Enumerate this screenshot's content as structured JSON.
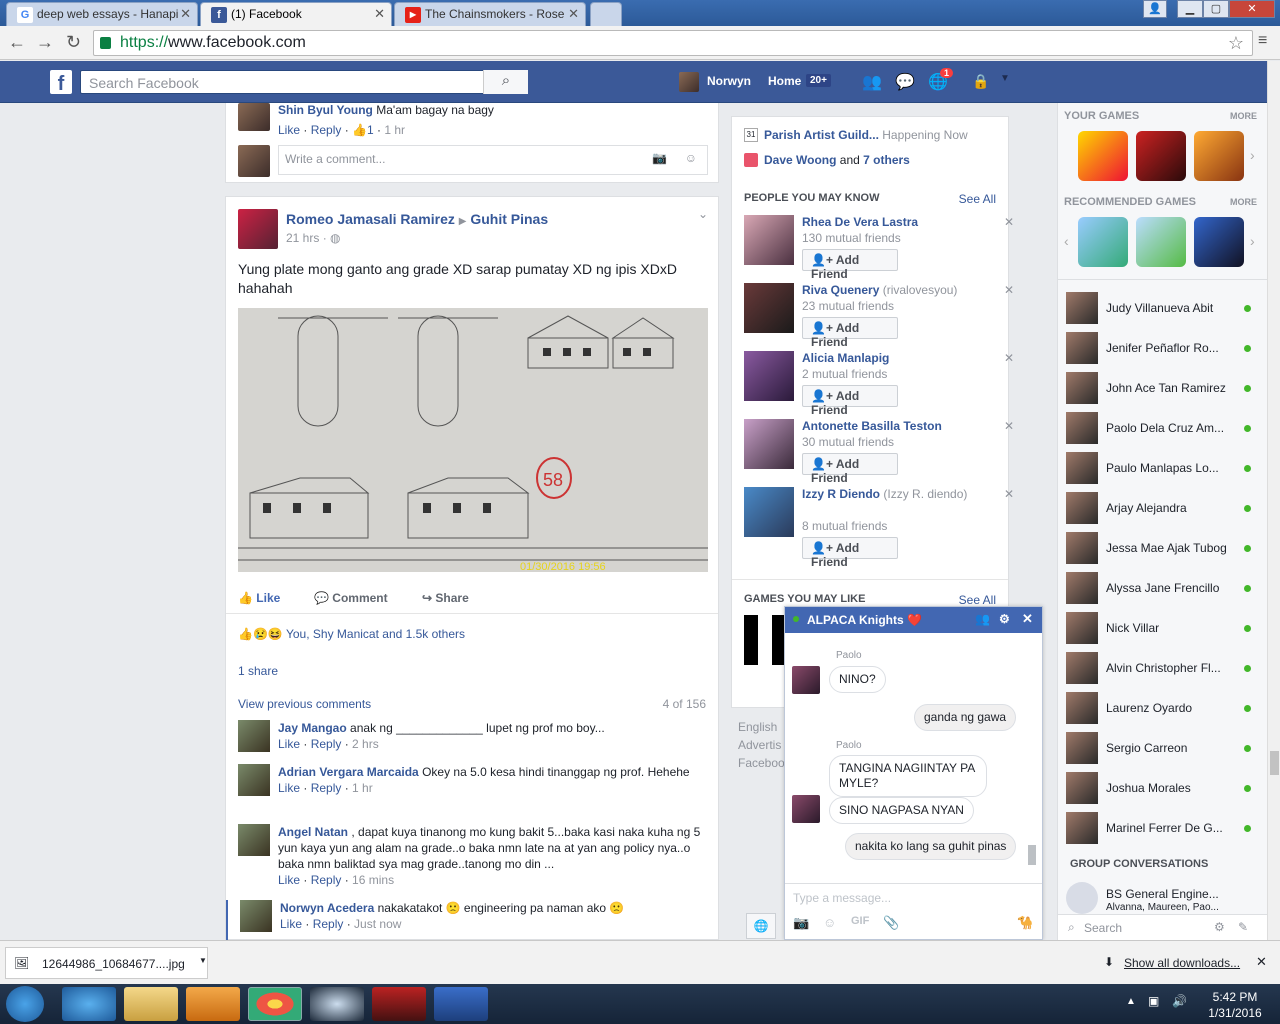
{
  "browser": {
    "tabs": [
      {
        "title": "deep web essays - Hanapi",
        "favicon": "google-icon",
        "active": false
      },
      {
        "title": "(1) Facebook",
        "favicon": "facebook-icon",
        "active": true
      },
      {
        "title": "The Chainsmokers - Rose",
        "favicon": "youtube-icon",
        "active": false
      }
    ],
    "url_scheme": "https://",
    "url_host": "www.facebook.com"
  },
  "fb_header": {
    "search_placeholder": "Search Facebook",
    "user_name": "Norwyn",
    "home_label": "Home",
    "home_badge": "20+",
    "notif_count": "1",
    "brand_color": "#3b5998"
  },
  "feed": {
    "top_comment": {
      "author": "Shin Byul Young",
      "text": "Ma'am bagay na bagy",
      "like": "Like",
      "reply": "Reply",
      "likes": "1",
      "time": "1 hr"
    },
    "write_comment_placeholder": "Write a comment...",
    "post": {
      "author": "Romeo Jamasali Ramirez",
      "group": "Guhit Pinas",
      "time": "21 hrs",
      "text": "Yung plate mong ganto ang grade XD sarap pumatay XD ng ipis XDxD hahahah",
      "photo_stamp": "01/30/2016  19:56",
      "grade_mark": "58",
      "actions": {
        "like": "Like",
        "comment": "Comment",
        "share": "Share"
      },
      "reactions": "You, Shy Manicat and 1.5k others",
      "shares": "1 share",
      "view_previous": "View previous comments",
      "comment_count": "4 of 156"
    },
    "comments": [
      {
        "author": "Jay Mangao",
        "text": "anak ng _____________ lupet ng prof mo boy...",
        "like": "Like",
        "reply": "Reply",
        "time": "2 hrs"
      },
      {
        "author": "Adrian Vergara Marcaida",
        "text": "Okey na 5.0 kesa hindi tinanggap ng prof. Hehehe",
        "like": "Like",
        "reply": "Reply",
        "time": "1 hr"
      },
      {
        "author": "Angel Natan",
        "text": ", dapat kuya tinanong mo kung bakit 5...baka kasi naka kuha ng 5 yun kaya yun ang alam na grade..o baka nmn late na at yan ang policy nya..o baka nmn baliktad sya mag grade..tanong mo din ...",
        "like": "Like",
        "reply": "Reply",
        "time": "16 mins"
      },
      {
        "author": "Norwyn Acedera",
        "text": "nakakatakot 🙁 engineering pa naman ako 🙁",
        "like": "Like",
        "reply": "Reply",
        "time": "Just now"
      }
    ]
  },
  "right_col": {
    "events": [
      {
        "name": "Parish Artist Guild...",
        "extra": "Happening Now",
        "icon_text": "31"
      },
      {
        "name": "Dave Woong",
        "extra": "and",
        "link2": "7 others"
      }
    ],
    "pymk_title": "PEOPLE YOU MAY KNOW",
    "see_all": "See All",
    "add_friend": "Add Friend",
    "people": [
      {
        "name": "Rhea De Vera Lastra",
        "sub": "",
        "mutual": "130 mutual friends"
      },
      {
        "name": "Riva Quenery",
        "sub": "(rivalovesyou)",
        "mutual": "23 mutual friends"
      },
      {
        "name": "Alicia Manlapig",
        "sub": "",
        "mutual": "2 mutual friends"
      },
      {
        "name": "Antonette Basilla Teston",
        "sub": "",
        "mutual": "30 mutual friends"
      },
      {
        "name": "Izzy R Diendo",
        "sub": "(Izzy R. diendo)",
        "mutual": "8 mutual friends"
      }
    ],
    "games_title": "GAMES YOU MAY LIKE",
    "footer_lines": [
      "English",
      "Advertis",
      "Faceboo"
    ]
  },
  "sidebar": {
    "your_games": "YOUR GAMES",
    "recommended_games": "RECOMMENDED GAMES",
    "more": "MORE",
    "contacts": [
      "Judy Villanueva Abit",
      "Jenifer Peñaflor Ro...",
      "John Ace Tan Ramirez",
      "Paolo Dela Cruz Am...",
      "Paulo Manlapas Lo...",
      "Arjay Alejandra",
      "Jessa Mae Ajak Tubog",
      "Alyssa Jane Frencillo",
      "Nick Villar",
      "Alvin Christopher Fl...",
      "Laurenz Oyardo",
      "Sergio Carreon",
      "Joshua Morales",
      "Marinel Ferrer De G..."
    ],
    "group_conv_title": "GROUP CONVERSATIONS",
    "group": {
      "name": "BS General Engine...",
      "members": "Alvanna, Maureen, Pao..."
    },
    "search_placeholder": "Search"
  },
  "chat": {
    "title": "ALPACA Knights ❤️",
    "messages": [
      {
        "sender": "Paolo",
        "text": "NINO?",
        "mine": false
      },
      {
        "sender": "",
        "text": "ganda ng gawa",
        "mine": true
      },
      {
        "sender": "Paolo",
        "text": "TANGINA NAGIINTAY PA MYLE?",
        "mine": false
      },
      {
        "sender": "",
        "text": "SINO NAGPASA NYAN",
        "mine": false
      },
      {
        "sender": "",
        "text": "nakita ko lang sa guhit pinas",
        "mine": true
      }
    ],
    "input_placeholder": "Type a message...",
    "gif_label": "GIF"
  },
  "downloads": {
    "file": "12644986_10684677....jpg",
    "show_all": "Show all downloads..."
  },
  "taskbar": {
    "time": "5:42 PM",
    "date": "1/31/2016"
  }
}
